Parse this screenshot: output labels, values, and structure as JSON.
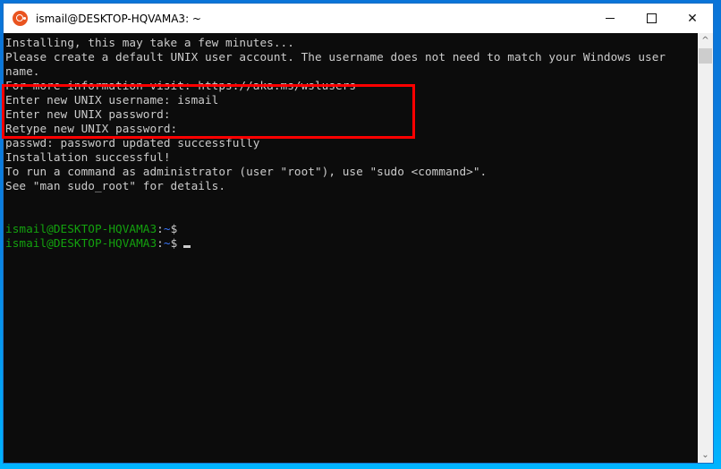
{
  "window": {
    "title": "ismail@DESKTOP-HQVAMA3: ~",
    "app_icon": "ubuntu-icon",
    "controls": {
      "minimize": "minimize-icon",
      "maximize": "maximize-icon",
      "close": "close-icon",
      "close_glyph": "✕"
    }
  },
  "terminal": {
    "lines": [
      "Installing, this may take a few minutes...",
      "Please create a default UNIX user account. The username does not need to match your Windows user",
      "name.",
      "For more information visit: https://aka.ms/wslusers",
      "Enter new UNIX username: ismail",
      "Enter new UNIX password:",
      "Retype new UNIX password:",
      "passwd: password updated successfully",
      "Installation successful!",
      "To run a command as administrator (user \"root\"), use \"sudo <command>\".",
      "See \"man sudo_root\" for details.",
      ""
    ],
    "prompts": [
      {
        "user_host": "ismail@DESKTOP-HQVAMA3",
        "sep": ":",
        "path": "~",
        "symbol": "$"
      },
      {
        "user_host": "ismail@DESKTOP-HQVAMA3",
        "sep": ":",
        "path": "~",
        "symbol": "$"
      }
    ]
  },
  "scrollbar": {
    "up_glyph": "^",
    "down_glyph": "⌄"
  },
  "colors": {
    "prompt_user": "#13a10e",
    "prompt_path": "#3b78ff",
    "highlight": "#ff0000",
    "background": "#0c0c0c",
    "text": "#cccccc"
  }
}
